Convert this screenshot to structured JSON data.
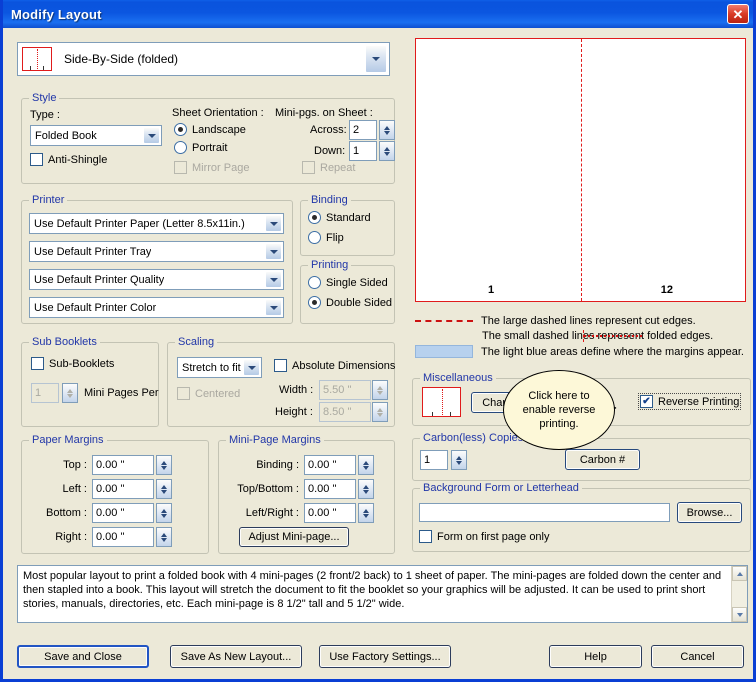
{
  "window": {
    "title": "Modify Layout",
    "close_label": "✕"
  },
  "layout_select": {
    "value": "Side-By-Side (folded)"
  },
  "style": {
    "legend": "Style",
    "type_label": "Type :",
    "type_value": "Folded Book",
    "anti_shingle": {
      "label": "Anti-Shingle",
      "checked": false
    },
    "orientation_label": "Sheet Orientation :",
    "orientation_options": [
      "Landscape",
      "Portrait"
    ],
    "orientation_selected": "Landscape",
    "mirror_page": {
      "label": "Mirror Page",
      "checked": false,
      "disabled": true
    },
    "minipgs_label": "Mini-pgs. on Sheet :",
    "across_label": "Across:",
    "across_value": "2",
    "down_label": "Down:",
    "down_value": "1",
    "repeat": {
      "label": "Repeat",
      "checked": false,
      "disabled": true
    }
  },
  "printer": {
    "legend": "Printer",
    "paper": "Use Default Printer Paper (Letter 8.5x11in.)",
    "tray": "Use Default Printer Tray",
    "quality": "Use Default Printer Quality",
    "color": "Use Default Printer Color"
  },
  "binding": {
    "legend": "Binding",
    "options": [
      "Standard",
      "Flip"
    ],
    "selected": "Standard"
  },
  "printing": {
    "legend": "Printing",
    "options": [
      "Single Sided",
      "Double Sided"
    ],
    "selected": "Double Sided"
  },
  "sub_booklets": {
    "legend": "Sub Booklets",
    "checkbox": {
      "label": "Sub-Booklets",
      "checked": false
    },
    "count_value": "1",
    "count_label": "Mini Pages Per"
  },
  "scaling": {
    "legend": "Scaling",
    "mode_value": "Stretch to fit",
    "absolute_dimensions": {
      "label": "Absolute Dimensions",
      "checked": false
    },
    "centered": {
      "label": "Centered",
      "checked": false,
      "disabled": true
    },
    "width_label": "Width :",
    "width_value": "5.50 \"",
    "height_label": "Height :",
    "height_value": "8.50 \""
  },
  "paper_margins": {
    "legend": "Paper Margins",
    "rows": [
      {
        "label": "Top :",
        "value": "0.00 \""
      },
      {
        "label": "Left :",
        "value": "0.00 \""
      },
      {
        "label": "Bottom :",
        "value": "0.00 \""
      },
      {
        "label": "Right :",
        "value": "0.00 \""
      }
    ]
  },
  "mini_page_margins": {
    "legend": "Mini-Page Margins",
    "rows": [
      {
        "label": "Binding :",
        "value": "0.00 \""
      },
      {
        "label": "Top/Bottom :",
        "value": "0.00 \""
      },
      {
        "label": "Left/Right :",
        "value": "0.00 \""
      }
    ],
    "adjust_button": "Adjust Mini-page..."
  },
  "preview": {
    "left_page": "1",
    "right_page": "12"
  },
  "legend_notes": [
    {
      "swatch": "cut",
      "text": "The large dashed lines represent cut edges."
    },
    {
      "swatch": "fold",
      "text": "The small dashed lines represent folded edges."
    },
    {
      "swatch": "blue",
      "text": "The light blue areas define where the margins appear."
    }
  ],
  "miscellaneous": {
    "legend": "Miscellaneous",
    "change_icon_button": "Change Icon...",
    "reverse_printing": {
      "label": "Reverse Printing",
      "checked": true
    }
  },
  "callout": {
    "text": "Click here to enable reverse printing."
  },
  "carbon": {
    "legend": "Carbon(less) Copies",
    "copies_value": "1",
    "button": "Carbon #"
  },
  "background_form": {
    "legend": "Background Form or Letterhead",
    "path_value": "",
    "browse_button": "Browse...",
    "first_page_only": {
      "label": "Form on first page only",
      "checked": false
    }
  },
  "description": {
    "text": "Most popular layout to print a folded book with 4 mini-pages (2 front/2 back) to 1 sheet of paper. The mini-pages are folded down the center and then stapled into a book.  This layout will stretch the document to fit the booklet so your graphics will be adjusted.  It can be used to print short stories, manuals, directories, etc.  Each mini-page is 8 1/2\" tall and 5 1/2\" wide."
  },
  "footer_buttons": {
    "save_and_close": "Save and Close",
    "save_as_new_layout": "Save As New Layout...",
    "use_factory_settings": "Use Factory Settings...",
    "help": "Help",
    "cancel": "Cancel"
  }
}
